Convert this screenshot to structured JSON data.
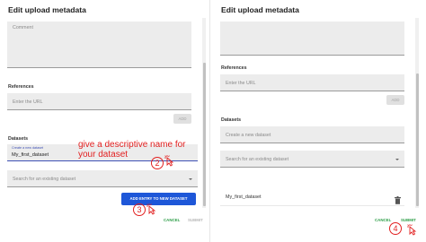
{
  "left": {
    "title": "Edit upload metadata",
    "comment_placeholder": "Comment",
    "references_label": "References",
    "url_placeholder": "Enter the URL",
    "add_label": "ADD",
    "datasets_label": "Datasets",
    "new_dataset_floating_label": "Create a new dataset",
    "new_dataset_value": "My_first_dataset",
    "search_placeholder": "Search for an existing dataset",
    "add_entry_label": "ADD ENTRY TO NEW DATASET",
    "cancel_label": "CANCEL",
    "submit_label": "SUBMIT"
  },
  "right": {
    "title": "Edit upload metadata",
    "references_label": "References",
    "url_placeholder": "Enter the URL",
    "add_label": "ADD",
    "datasets_label": "Datasets",
    "new_dataset_placeholder": "Create a new dataset",
    "search_placeholder": "Search for an existing dataset",
    "dataset_item": "My_first_dataset",
    "cancel_label": "CANCEL",
    "submit_label": "SUBMIT"
  },
  "annotations": {
    "note_line1": "give a descriptive name for",
    "note_line2": "your dataset",
    "step2": "2",
    "step3": "3",
    "step4": "4"
  },
  "colors": {
    "primary": "#1e57d8",
    "accent_green": "#2e9e48",
    "annotation_red": "#e22020",
    "field_bg": "#ececec"
  }
}
